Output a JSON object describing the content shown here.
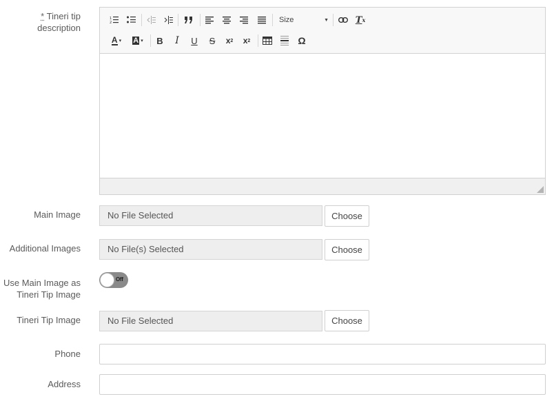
{
  "fields": {
    "description": {
      "required_mark": "*",
      "label": "Tineri tip description"
    },
    "main_image": {
      "label": "Main Image",
      "value": "No File Selected",
      "button": "Choose"
    },
    "additional_images": {
      "label": "Additional Images",
      "value": "No File(s) Selected",
      "button": "Choose"
    },
    "use_main_image": {
      "label": "Use Main Image as Tineri Tip Image",
      "toggle_text": "Off",
      "state": "off"
    },
    "tip_image": {
      "label": "Tineri Tip Image",
      "value": "No File Selected",
      "button": "Choose"
    },
    "phone": {
      "label": "Phone",
      "value": ""
    },
    "address": {
      "label": "Address",
      "value": ""
    }
  },
  "editor": {
    "toolbar_row1": [
      "numbered-list-icon",
      "bulleted-list-icon",
      "outdent-icon",
      "indent-icon",
      "blockquote-icon",
      "align-left-icon",
      "align-center-icon",
      "align-right-icon",
      "align-justify-icon",
      "size-select",
      "link-icon",
      "remove-format-icon"
    ],
    "size_label": "Size",
    "toolbar_row2": [
      "text-color-icon",
      "background-color-icon",
      "bold-icon",
      "italic-icon",
      "underline-icon",
      "strikethrough-icon",
      "subscript-icon",
      "superscript-icon",
      "table-icon",
      "horizontal-rule-icon",
      "special-character-icon"
    ],
    "glyphs": {
      "text_color": "A",
      "bg_color": "A",
      "bold": "B",
      "italic": "I",
      "underline": "U",
      "strike": "S",
      "subscript": "x",
      "subscript_small": "2",
      "superscript": "x",
      "superscript_small": "2",
      "omega": "Ω",
      "remove_format": "T",
      "remove_format_small": "x"
    }
  },
  "colors": {
    "toggle_off": "#8a8a8a",
    "readonly_field": "#eeeeee",
    "border": "#d1d1d1"
  }
}
